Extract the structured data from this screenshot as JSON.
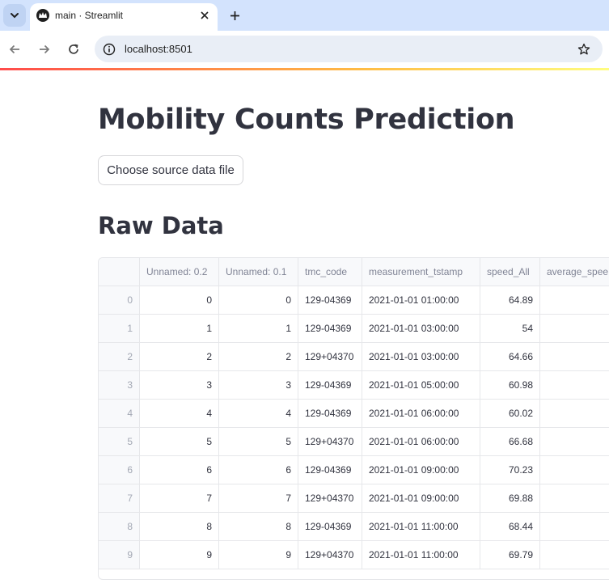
{
  "browser": {
    "tab_title": "main · Streamlit",
    "url": "localhost:8501"
  },
  "page": {
    "title": "Mobility Counts Prediction",
    "upload_button_label": "Choose source data file",
    "raw_data_heading": "Raw Data"
  },
  "table": {
    "columns": [
      "",
      "Unnamed: 0.2",
      "Unnamed: 0.1",
      "tmc_code",
      "measurement_tstamp",
      "speed_All",
      "average_spee"
    ],
    "rows": [
      [
        "0",
        "0",
        "0",
        "129-04369",
        "2021-01-01 01:00:00",
        "64.89",
        ""
      ],
      [
        "1",
        "1",
        "1",
        "129-04369",
        "2021-01-01 03:00:00",
        "54",
        ""
      ],
      [
        "2",
        "2",
        "2",
        "129+04370",
        "2021-01-01 03:00:00",
        "64.66",
        ""
      ],
      [
        "3",
        "3",
        "3",
        "129-04369",
        "2021-01-01 05:00:00",
        "60.98",
        ""
      ],
      [
        "4",
        "4",
        "4",
        "129-04369",
        "2021-01-01 06:00:00",
        "60.02",
        ""
      ],
      [
        "5",
        "5",
        "5",
        "129+04370",
        "2021-01-01 06:00:00",
        "66.68",
        ""
      ],
      [
        "6",
        "6",
        "6",
        "129-04369",
        "2021-01-01 09:00:00",
        "70.23",
        ""
      ],
      [
        "7",
        "7",
        "7",
        "129+04370",
        "2021-01-01 09:00:00",
        "69.88",
        ""
      ],
      [
        "8",
        "8",
        "8",
        "129-04369",
        "2021-01-01 11:00:00",
        "68.44",
        ""
      ],
      [
        "9",
        "9",
        "9",
        "129+04370",
        "2021-01-01 11:00:00",
        "69.79",
        ""
      ]
    ]
  },
  "icons": {
    "tab_menu": "chevron-down-icon",
    "favicon": "streamlit-crown-icon",
    "close": "close-icon",
    "new_tab": "plus-icon",
    "back": "arrow-left-icon",
    "forward": "arrow-right-icon",
    "reload": "reload-icon",
    "site_info": "info-icon",
    "bookmark": "star-icon"
  },
  "colors": {
    "accent_red": "#ff4b4b",
    "tabbar_bg": "#d3e3fd",
    "text": "#31333f"
  }
}
